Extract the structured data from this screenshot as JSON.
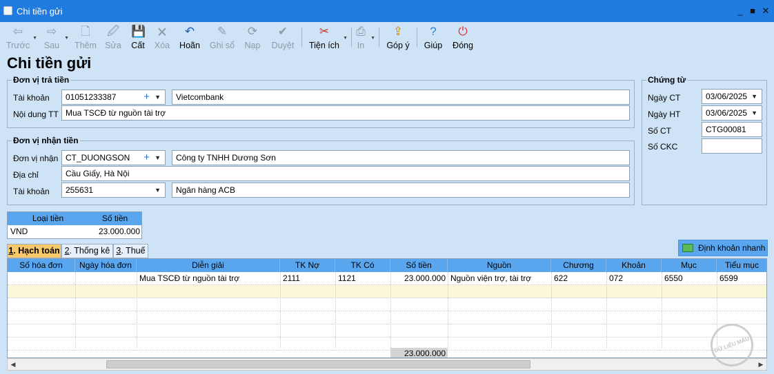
{
  "window": {
    "title": "Chi tiền gửi",
    "minimize": "_",
    "maximize": "■",
    "close": "✕"
  },
  "toolbar": [
    {
      "id": "prev",
      "label": "Trước",
      "icon": "⇦",
      "enabled": false,
      "color": "#8e9aa8",
      "dropdown": true
    },
    {
      "id": "next",
      "label": "Sau",
      "icon": "⇨",
      "enabled": false,
      "color": "#8e9aa8",
      "dropdown": true
    },
    {
      "id": "add",
      "label": "Thêm",
      "icon": "🗋",
      "enabled": false,
      "color": "#8e9aa8",
      "dropdown": false
    },
    {
      "id": "edit",
      "label": "Sửa",
      "icon": "🖉",
      "enabled": false,
      "color": "#8e9aa8",
      "dropdown": false
    },
    {
      "id": "save",
      "label": "Cất",
      "icon": "💾",
      "enabled": true,
      "color": "#1a5fb4",
      "dropdown": false
    },
    {
      "id": "delete",
      "label": "Xóa",
      "icon": "🗙",
      "enabled": false,
      "color": "#8e9aa8",
      "dropdown": false
    },
    {
      "id": "undo",
      "label": "Hoãn",
      "icon": "↶",
      "enabled": true,
      "color": "#1a5fb4",
      "dropdown": false
    },
    {
      "id": "post",
      "label": "Ghi sổ",
      "icon": "✎",
      "enabled": false,
      "color": "#8e9aa8",
      "dropdown": false
    },
    {
      "id": "load",
      "label": "Nạp",
      "icon": "⟳",
      "enabled": false,
      "color": "#8e9aa8",
      "dropdown": false
    },
    {
      "id": "approve",
      "label": "Duyệt",
      "icon": "✔",
      "enabled": false,
      "color": "#8e9aa8",
      "dropdown": false
    },
    {
      "id": "utilities",
      "label": "Tiện ích",
      "icon": "✂",
      "enabled": true,
      "color": "#c0392b",
      "dropdown": true
    },
    {
      "id": "print",
      "label": "In",
      "icon": "⎙",
      "enabled": false,
      "color": "#8e9aa8",
      "dropdown": true
    },
    {
      "id": "feedback",
      "label": "Góp ý",
      "icon": "⇪",
      "enabled": true,
      "color": "#c98a00",
      "dropdown": false
    },
    {
      "id": "help",
      "label": "Giúp",
      "icon": "?",
      "enabled": true,
      "color": "#2a7de1",
      "dropdown": false
    },
    {
      "id": "close",
      "label": "Đóng",
      "icon": "⏻",
      "enabled": true,
      "color": "#e0312b",
      "dropdown": false
    }
  ],
  "page_title": "Chi tiền gửi",
  "payer": {
    "legend": "Đơn vị trả tiền",
    "account_label": "Tài khoản",
    "account_value": "01051233387",
    "bank_name": "Vietcombank",
    "content_label": "Nội dung TT",
    "content_value": "Mua TSCĐ từ nguồn tài trợ"
  },
  "payee": {
    "legend": "Đơn vị nhận tiền",
    "unit_label": "Đơn vị nhận",
    "unit_code": "CT_DUONGSON",
    "unit_name": "Công ty TNHH Dương Sơn",
    "address_label": "Địa chỉ",
    "address_value": "Cầu Giấy, Hà Nội",
    "account_label": "Tài khoản",
    "account_value": "255631",
    "bank_name": "Ngân hàng ACB"
  },
  "voucher": {
    "legend": "Chứng từ",
    "date_ct_label": "Ngày CT",
    "date_ct_value": "03/06/2025",
    "date_ht_label": "Ngày HT",
    "date_ht_value": "03/06/2025",
    "number_label": "Số CT",
    "number_value": "CTG00081",
    "ckc_label": "Số CKC",
    "ckc_value": ""
  },
  "currency": {
    "type_header": "Loại tiền",
    "amount_header": "Số tiền",
    "type_value": "VND",
    "amount_value": "23.000.000"
  },
  "tabs": [
    {
      "num": "1",
      "label": ". Hạch toán",
      "active": true
    },
    {
      "num": "2",
      "label": ". Thống kê",
      "active": false
    },
    {
      "num": "3",
      "label": ". Thuế",
      "active": false
    }
  ],
  "quick_entry_label": "Định khoản nhanh",
  "grid": {
    "columns": [
      "Số hóa đơn",
      "Ngày hóa đơn",
      "Diễn giải",
      "TK Nợ",
      "TK Có",
      "Số tiền",
      "Nguồn",
      "Chương",
      "Khoản",
      "Mục",
      "Tiểu mục"
    ],
    "rows": [
      [
        "",
        "",
        "Mua TSCĐ từ nguồn tài trợ",
        "2111",
        "1121",
        "23.000.000",
        "Nguồn viện trợ, tài trợ",
        "622",
        "072",
        "6550",
        "6599"
      ]
    ],
    "total": "23.000.000"
  },
  "watermark_text": "DỮ LIỆU MẪU"
}
